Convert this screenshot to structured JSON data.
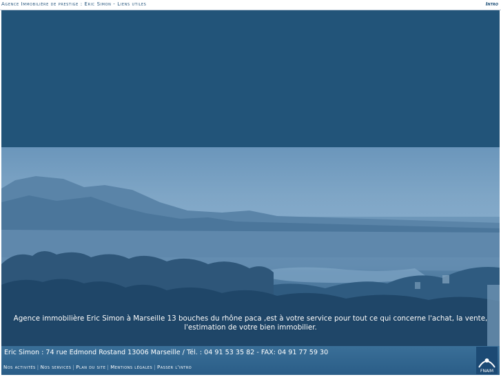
{
  "topbar": {
    "breadcrumb": "Agence Immobilière de prestige : Eric Simon - Liens utiles",
    "intro_link": "Intro"
  },
  "hero": {
    "caption": "Agence immobilière Eric Simon à Marseille 13 bouches du rhône paca ,est à votre service pour tout ce qui concerne l'achat, la vente, l'estimation de votre bien immobilier."
  },
  "footer": {
    "address": "Eric Simon : 74 rue Edmond Rostand 13006 Marseille / Tél. : 04 91 53 35 82 - FAX: 04 91 77 59 30",
    "links": [
      "Nos activités",
      "Nos services",
      "Plan du site",
      "Mentions légales",
      "Passer l'intro"
    ],
    "separator": "|",
    "badge_text": "FNAIM"
  },
  "colors": {
    "sky": "#225479",
    "footer": "#2f6690",
    "text_dark": "#1e4f78"
  }
}
